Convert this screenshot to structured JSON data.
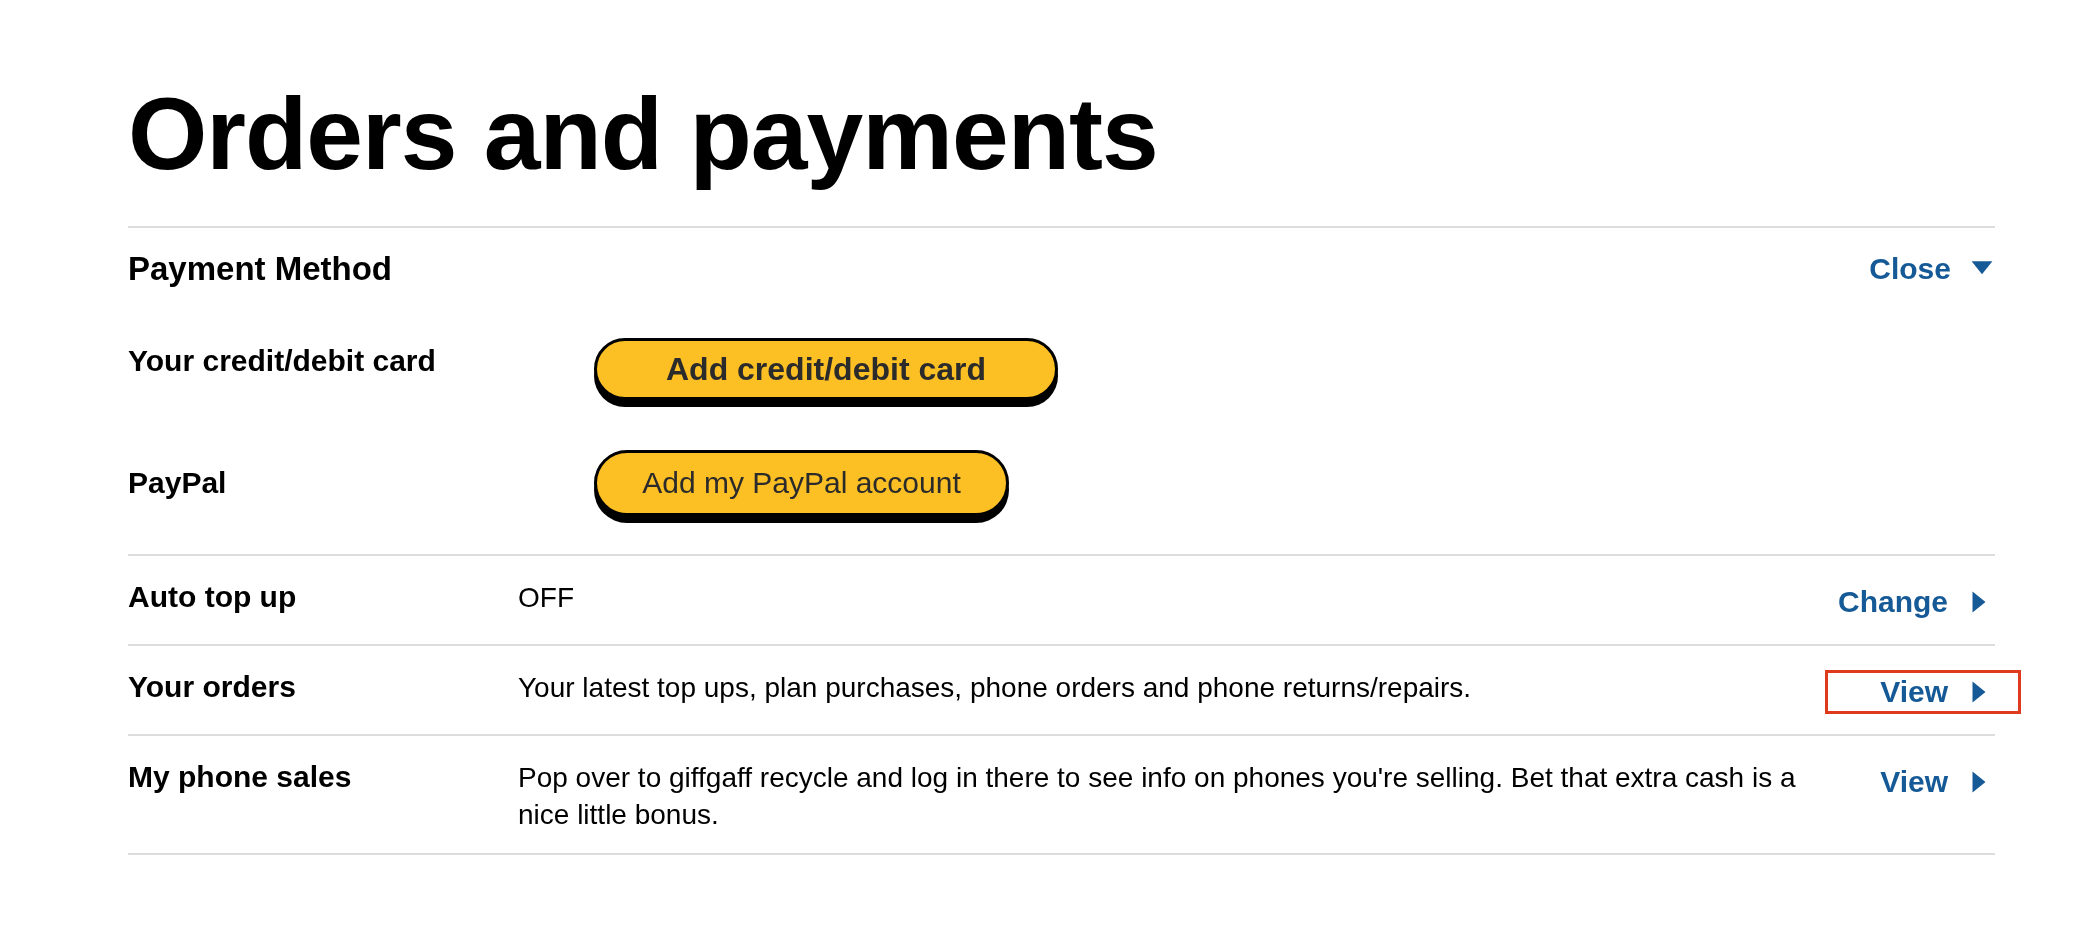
{
  "title": "Orders and payments",
  "payment_method": {
    "heading": "Payment Method",
    "toggle": {
      "label": "Close",
      "expanded": true
    },
    "options": [
      {
        "label": "Your credit/debit card",
        "button": "Add credit/debit card",
        "kind": "bold"
      },
      {
        "label": "PayPal",
        "button": "Add my PayPal account",
        "kind": "plain"
      }
    ]
  },
  "rows": [
    {
      "label": "Auto top up",
      "value": "OFF",
      "action": {
        "label": "Change",
        "highlighted": false
      }
    },
    {
      "label": "Your orders",
      "value": "Your latest top ups, plan purchases, phone orders and phone returns/repairs.",
      "action": {
        "label": "View",
        "highlighted": true
      }
    },
    {
      "label": "My phone sales",
      "value": "Pop over to giffgaff recycle and log in there to see info on phones you're selling. Bet that extra cash is a nice little bonus.",
      "action": {
        "label": "View",
        "highlighted": false
      }
    }
  ]
}
